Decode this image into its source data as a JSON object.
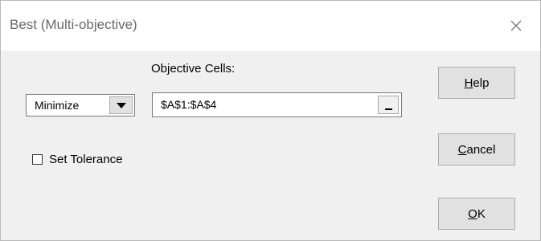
{
  "window": {
    "title": "Best (Multi-objective)",
    "close_icon": "close-icon"
  },
  "objective": {
    "label": "Objective Cells:",
    "value": "$A$1:$A$4",
    "collapse_icon": "range-select-icon"
  },
  "direction": {
    "selected": "Minimize"
  },
  "tolerance": {
    "label": "Set Tolerance",
    "checked": false
  },
  "buttons": {
    "help": {
      "mnemonic": "H",
      "rest": "elp"
    },
    "cancel": {
      "mnemonic": "C",
      "rest": "ancel"
    },
    "ok": {
      "mnemonic": "O",
      "rest": "K"
    }
  },
  "colors": {
    "focus_border": "#0078d7",
    "dialog_bg": "#f0f0f0"
  }
}
